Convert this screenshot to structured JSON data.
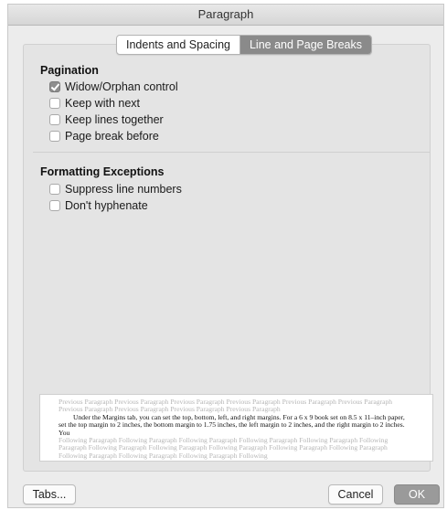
{
  "window": {
    "title": "Paragraph"
  },
  "tabs": [
    {
      "label": "Indents and Spacing",
      "selected": false
    },
    {
      "label": "Line and Page Breaks",
      "selected": true
    }
  ],
  "pagination": {
    "title": "Pagination",
    "options": [
      {
        "label": "Widow/Orphan control",
        "checked": true
      },
      {
        "label": "Keep with next",
        "checked": false
      },
      {
        "label": "Keep lines together",
        "checked": false
      },
      {
        "label": "Page break before",
        "checked": false
      }
    ]
  },
  "formatting_exceptions": {
    "title": "Formatting Exceptions",
    "options": [
      {
        "label": "Suppress line numbers",
        "checked": false
      },
      {
        "label": "Don't hyphenate",
        "checked": false
      }
    ]
  },
  "preview": {
    "previous": "Previous Paragraph Previous Paragraph Previous Paragraph Previous Paragraph Previous Paragraph Previous Paragraph Previous Paragraph Previous Paragraph Previous Paragraph Previous Paragraph",
    "body": "Under the Margins tab, you can set the top, bottom, left, and right margins. For a 6 x 9 book set on 8.5 x 11–inch paper, set the top margin to 2 inches, the bottom margin to 1.75 inches, the left margin to 2 inches, and the right margin to 2 inches. You",
    "following": "Following Paragraph Following Paragraph Following Paragraph Following Paragraph Following Paragraph Following Paragraph Following Paragraph Following Paragraph Following Paragraph Following Paragraph Following Paragraph Following Paragraph Following Paragraph Following Paragraph Following"
  },
  "buttons": {
    "tabs": "Tabs...",
    "cancel": "Cancel",
    "ok": "OK"
  }
}
